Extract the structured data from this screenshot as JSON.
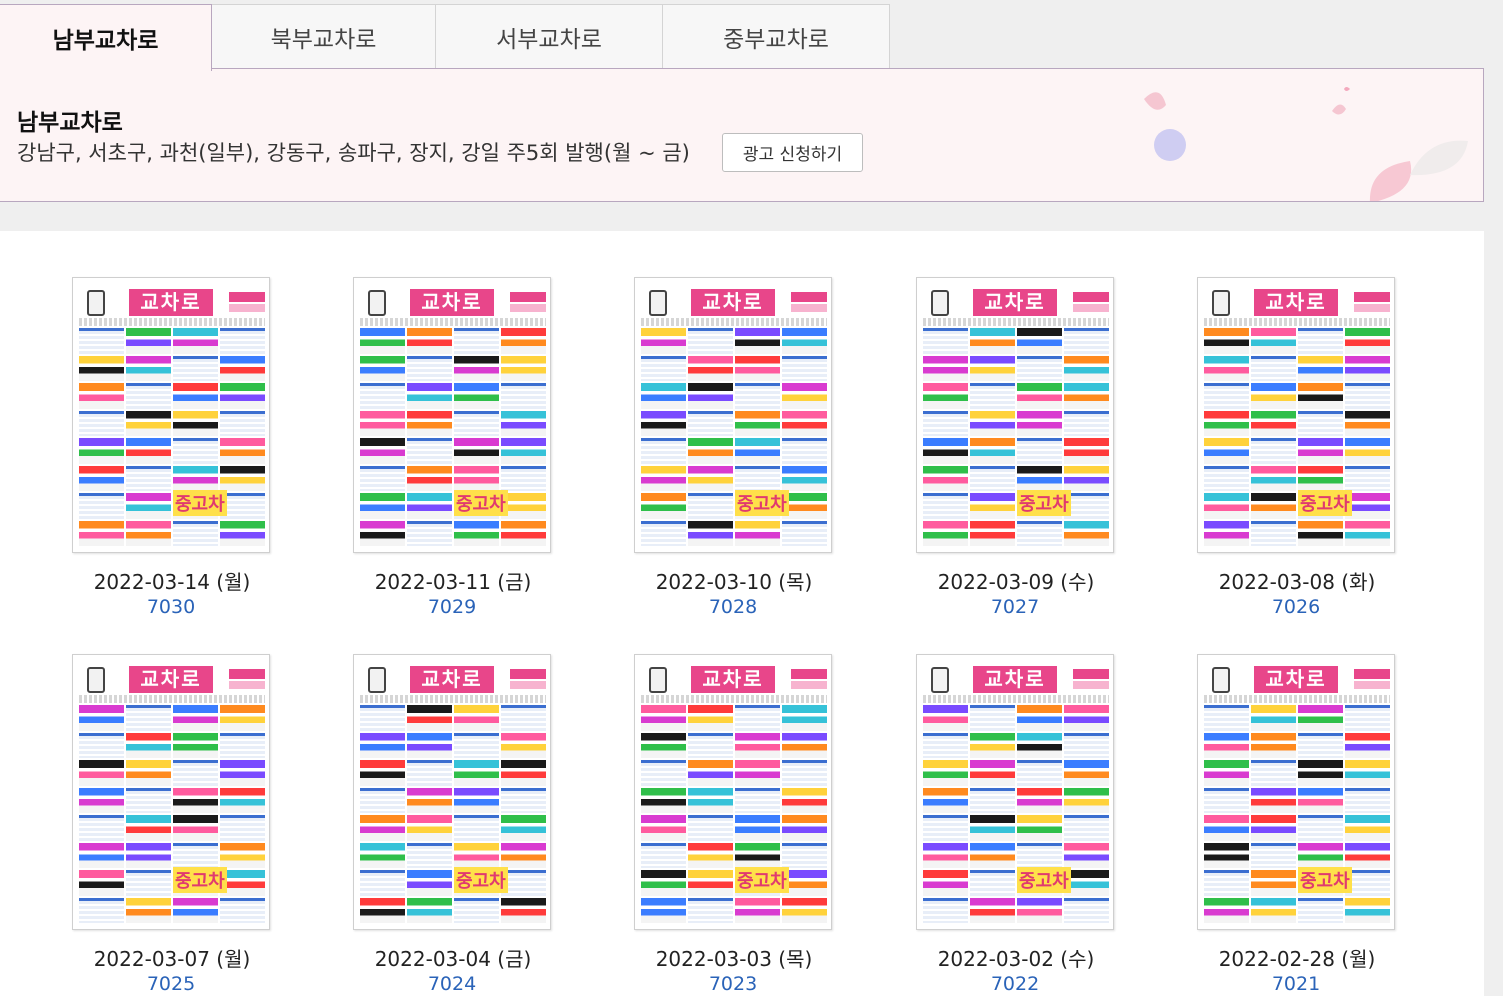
{
  "tabs": [
    {
      "label": "남부교차로",
      "active": true
    },
    {
      "label": "북부교차로",
      "active": false
    },
    {
      "label": "서부교차로",
      "active": false
    },
    {
      "label": "중부교차로",
      "active": false
    }
  ],
  "panel": {
    "title": "남부교차로",
    "description": "강남구, 서초구, 과천(일부), 강동구, 송파구, 장지, 강일 주5회 발행(월 ~ 금)",
    "apply_button": "광고 신청하기"
  },
  "thumbnail": {
    "logo_text": "교차로",
    "used_car_text": "중고차"
  },
  "issues": [
    {
      "date": "2022-03-14 (월)",
      "number": "7030"
    },
    {
      "date": "2022-03-11 (금)",
      "number": "7029"
    },
    {
      "date": "2022-03-10 (목)",
      "number": "7028"
    },
    {
      "date": "2022-03-09 (수)",
      "number": "7027"
    },
    {
      "date": "2022-03-08 (화)",
      "number": "7026"
    },
    {
      "date": "2022-03-07 (월)",
      "number": "7025"
    },
    {
      "date": "2022-03-04 (금)",
      "number": "7024"
    },
    {
      "date": "2022-03-03 (목)",
      "number": "7023"
    },
    {
      "date": "2022-03-02 (수)",
      "number": "7022"
    },
    {
      "date": "2022-02-28 (월)",
      "number": "7021"
    }
  ],
  "colors": {
    "accent_pink": "#e8468a",
    "link_blue": "#2a63b8",
    "panel_bg": "#fdf4f5"
  }
}
